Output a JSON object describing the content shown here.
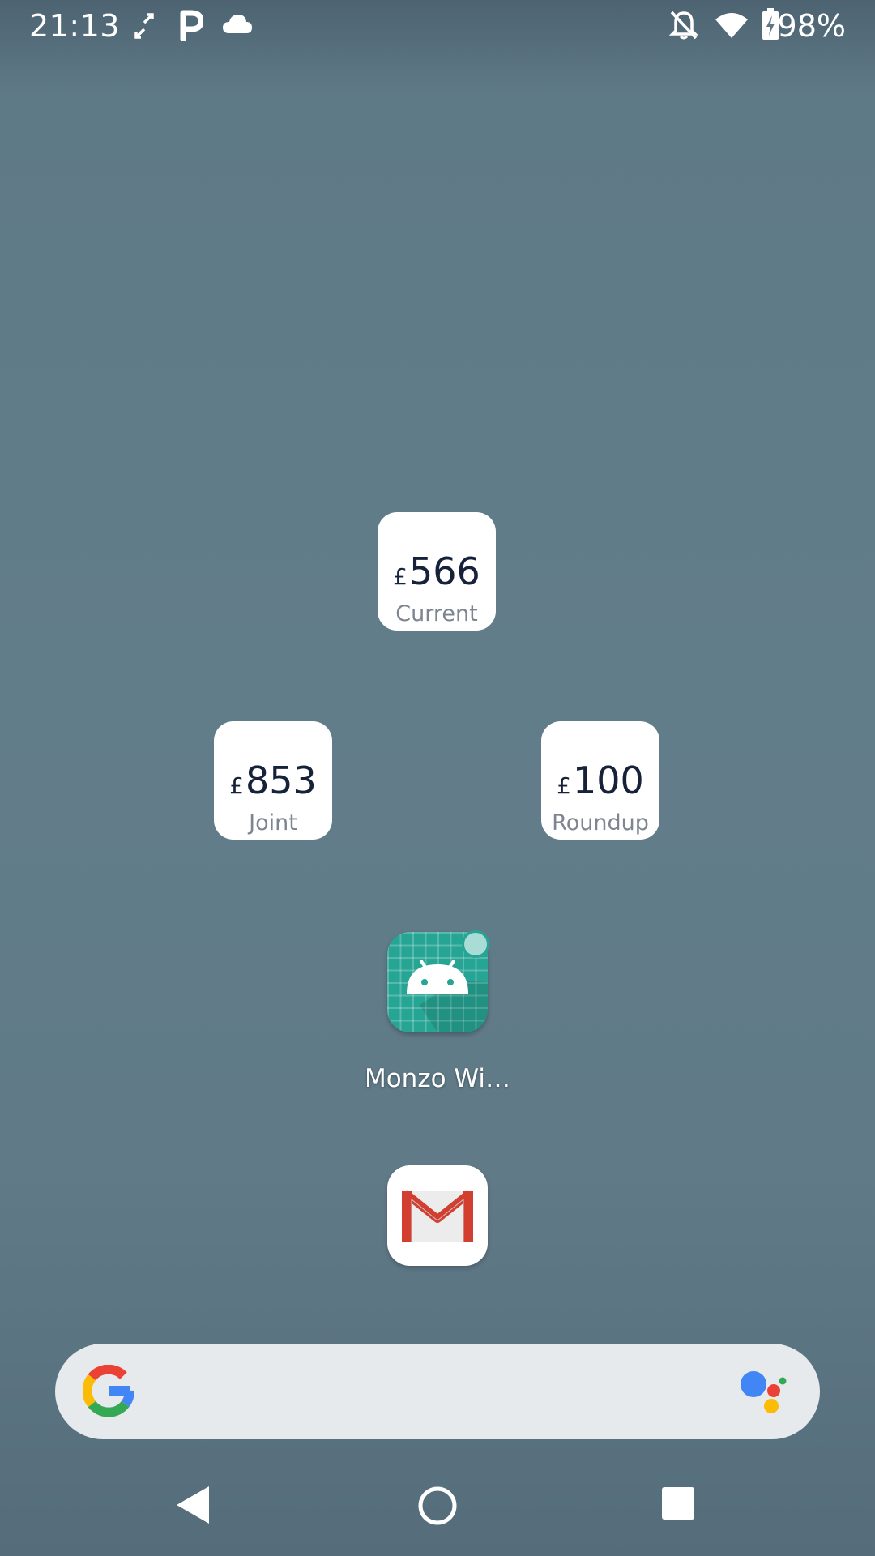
{
  "status_bar": {
    "time": "21:13",
    "battery": "98%",
    "left_icons": [
      "sync-icon",
      "parking-icon",
      "cloud-icon"
    ],
    "right_icons": [
      "notifications-off-icon",
      "wifi-icon",
      "battery-charging-icon"
    ]
  },
  "widgets": [
    {
      "currency": "£",
      "amount": "566",
      "label": "Current"
    },
    {
      "currency": "£",
      "amount": "853",
      "label": "Joint"
    },
    {
      "currency": "£",
      "amount": "100",
      "label": "Roundup"
    }
  ],
  "apps": {
    "monzo_label": "Monzo Wi…",
    "gmail_icon": "gmail-icon"
  },
  "search": {
    "left_icon": "google-g-icon",
    "right_icon": "google-assistant-icon"
  },
  "nav": [
    "back-icon",
    "home-icon",
    "recents-icon"
  ],
  "colors": {
    "monzo_teal": "#26a595",
    "widget_text": "#16223a",
    "widget_label": "#7d8590"
  }
}
